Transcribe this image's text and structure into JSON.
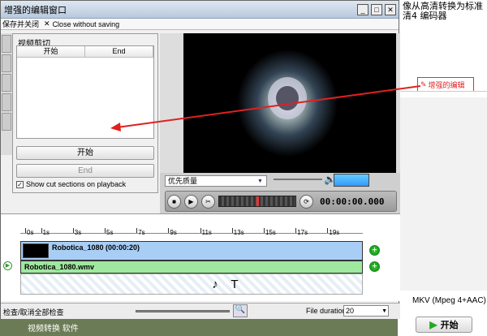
{
  "background_app": {
    "header_text": "像从高清转换为标准清4 编码器",
    "tag_label": "增强的编辑",
    "format_label": "MKV (Mpeg 4+AAC)",
    "start_label": "开始",
    "footer_text": "视频转换 软件"
  },
  "window": {
    "title": "增强的编辑窗口",
    "menu": {
      "save_close": "保存并关闭",
      "close_without_saving": "Close without saving"
    }
  },
  "cut_panel": {
    "legend": "视频剪切",
    "columns": [
      "开始",
      "End"
    ],
    "start_button": "开始",
    "end_button": "End",
    "show_cut_label": "Show cut sections on playback",
    "show_cut_checked": true
  },
  "player": {
    "quality": "优先质量",
    "timecode": "00:00:00.000"
  },
  "timeline": {
    "ruler_labels": [
      "0s",
      "1s",
      "3s",
      "5s",
      "7s",
      "9s",
      "11s",
      "13s",
      "15s",
      "17s",
      "19s"
    ],
    "video_track_name": "Robotica_1080 (00:00:20)",
    "audio_track_name": "Robotica_1080.wmv"
  },
  "statusbar": {
    "check_label": "检查/取消全部检查",
    "file_duration_label": "File duration:",
    "file_duration_value": "20"
  },
  "colors": {
    "video_track": "#a8cef5",
    "audio_track": "#9fe89f",
    "annotation_arrow": "#e02020"
  }
}
